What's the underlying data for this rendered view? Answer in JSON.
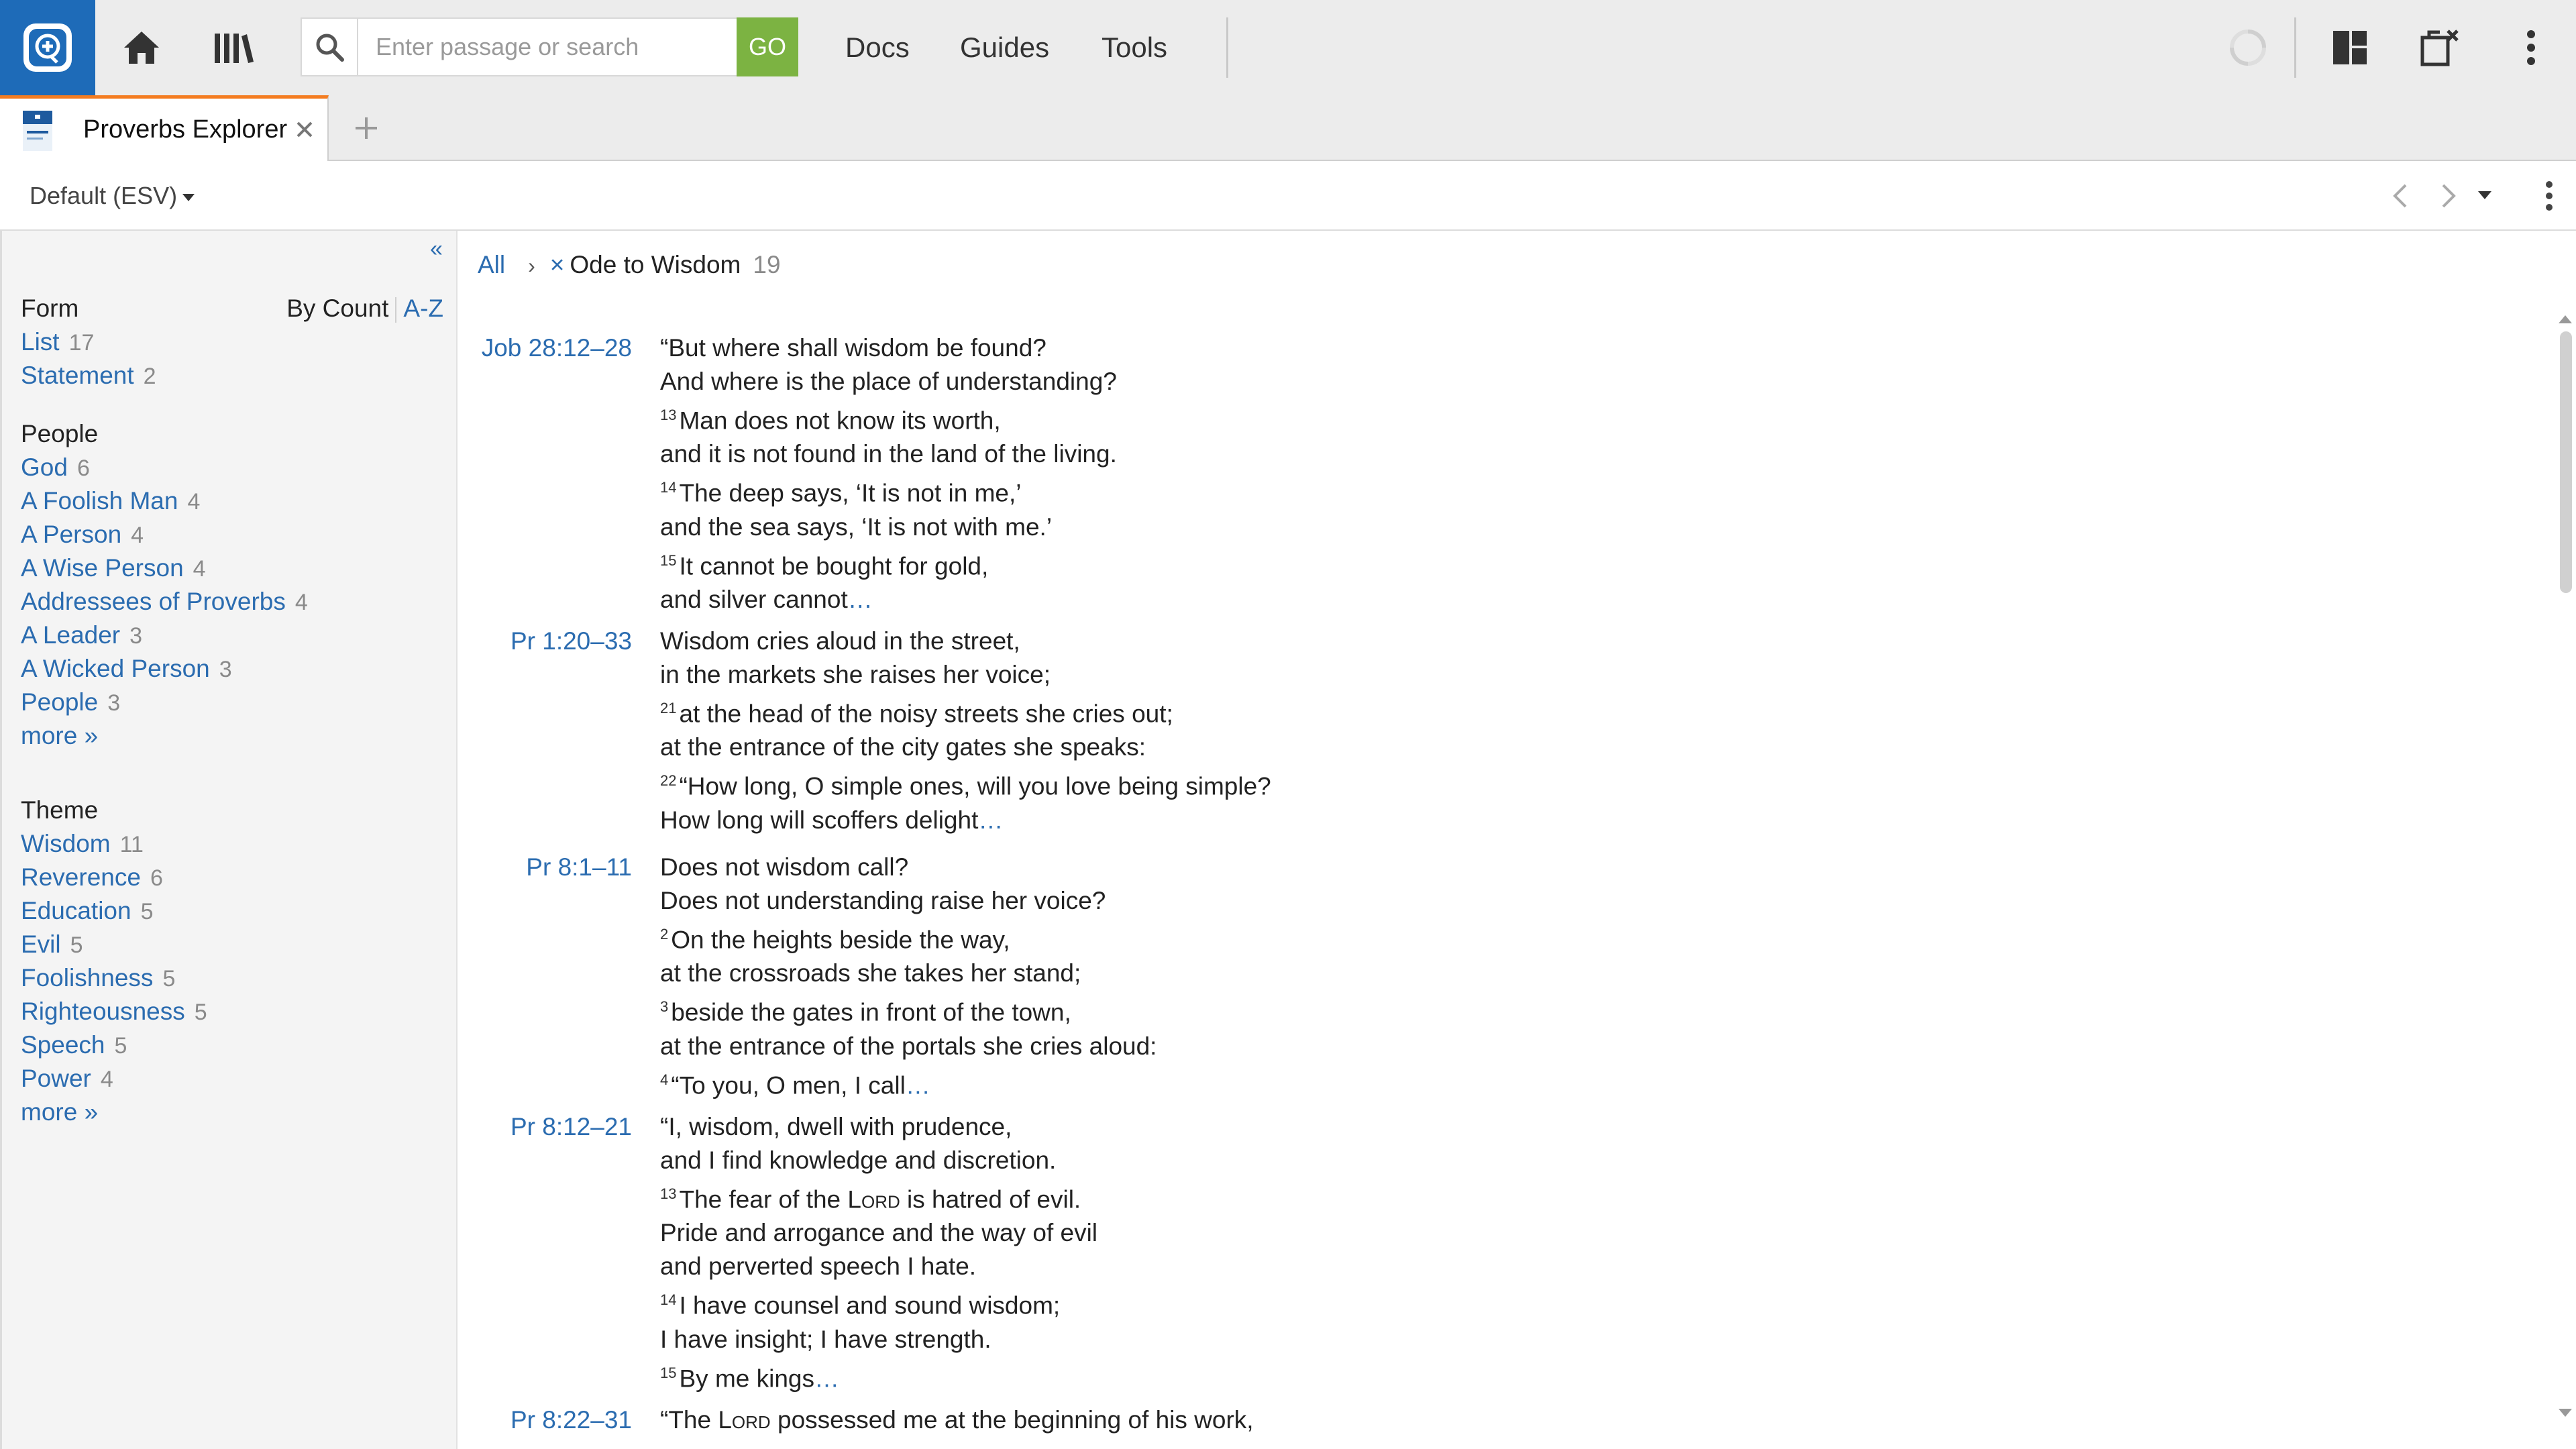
{
  "topbar": {
    "search_placeholder": "Enter passage or search",
    "go_label": "GO",
    "nav": [
      "Docs",
      "Guides",
      "Tools"
    ]
  },
  "tab": {
    "title": "Proverbs Explorer"
  },
  "toolbar": {
    "version_label": "Default (ESV)"
  },
  "sidebar": {
    "collapse_label": "«",
    "form": {
      "heading": "Form",
      "sort_by_count": "By Count",
      "sort_az": "A-Z",
      "items": [
        {
          "label": "List",
          "count": "17"
        },
        {
          "label": "Statement",
          "count": "2"
        }
      ]
    },
    "people": {
      "heading": "People",
      "items": [
        {
          "label": "God",
          "count": "6"
        },
        {
          "label": "A Foolish Man",
          "count": "4"
        },
        {
          "label": "A Person",
          "count": "4"
        },
        {
          "label": "A Wise Person",
          "count": "4"
        },
        {
          "label": "Addressees of Proverbs",
          "count": "4"
        },
        {
          "label": "A Leader",
          "count": "3"
        },
        {
          "label": "A Wicked Person",
          "count": "3"
        },
        {
          "label": "People",
          "count": "3"
        }
      ],
      "more": "more »"
    },
    "theme": {
      "heading": "Theme",
      "items": [
        {
          "label": "Wisdom",
          "count": "11"
        },
        {
          "label": "Reverence",
          "count": "6"
        },
        {
          "label": "Education",
          "count": "5"
        },
        {
          "label": "Evil",
          "count": "5"
        },
        {
          "label": "Foolishness",
          "count": "5"
        },
        {
          "label": "Righteousness",
          "count": "5"
        },
        {
          "label": "Speech",
          "count": "5"
        },
        {
          "label": "Power",
          "count": "4"
        }
      ],
      "more": "more »"
    }
  },
  "breadcrumb": {
    "all": "All",
    "sep": "›",
    "remove": "×",
    "current": "Ode to Wisdom",
    "count": "19"
  },
  "results": [
    {
      "ref": "Job 28:12–28",
      "lines": [
        {
          "v": "",
          "t": "“But where shall wisdom be found?"
        },
        {
          "v": "",
          "t": "And where is the place of understanding?"
        },
        {
          "v": "13",
          "t": "Man does not know its worth,"
        },
        {
          "v": "",
          "t": "and it is not found in the land of the living."
        },
        {
          "v": "14",
          "t": "The deep says, ‘It is not in me,’"
        },
        {
          "v": "",
          "t": "and the sea says, ‘It is not with me.’"
        },
        {
          "v": "15",
          "t": "It cannot be bought for gold,"
        },
        {
          "v": "",
          "t": "and silver cannot",
          "more": "…"
        }
      ]
    },
    {
      "ref": "Pr 1:20–33",
      "lines": [
        {
          "v": "",
          "t": "Wisdom cries aloud in the street,"
        },
        {
          "v": "",
          "t": "in the markets she raises her voice;"
        },
        {
          "v": "21",
          "t": "at the head of the noisy streets she cries out;"
        },
        {
          "v": "",
          "t": "at the entrance of the city gates she speaks:"
        },
        {
          "v": "22",
          "t": "“How long, O simple ones, will you love being simple?"
        },
        {
          "v": "",
          "t": "How long will scoffers delight",
          "more": "…"
        }
      ]
    },
    {
      "ref": "Pr 8:1–11",
      "lines": [
        {
          "v": "",
          "t": "Does not wisdom call?"
        },
        {
          "v": "",
          "t": "Does not understanding raise her voice?"
        },
        {
          "v": "2",
          "t": "On the heights beside the way,"
        },
        {
          "v": "",
          "t": "at the crossroads she takes her stand;"
        },
        {
          "v": "3",
          "t": "beside the gates in front of the town,"
        },
        {
          "v": "",
          "t": "at the entrance of the portals she cries aloud:"
        },
        {
          "v": "4",
          "t": "“To you, O men, I call",
          "more": "…"
        }
      ]
    },
    {
      "ref": "Pr 8:12–21",
      "lines": [
        {
          "v": "",
          "t": "“I, wisdom, dwell with prudence,"
        },
        {
          "v": "",
          "t": "and I find knowledge and discretion."
        },
        {
          "v": "13",
          "t": "The fear of the ",
          "sc": "Lord",
          "after": " is hatred of evil."
        },
        {
          "v": "",
          "t": "Pride and arrogance and the way of evil"
        },
        {
          "v": "",
          "t": "and perverted speech I hate."
        },
        {
          "v": "14",
          "t": "I have counsel and sound wisdom;"
        },
        {
          "v": "",
          "t": "I have insight; I have strength."
        },
        {
          "v": "15",
          "t": "By me kings",
          "more": "…"
        }
      ]
    },
    {
      "ref": "Pr 8:22–31",
      "lines": [
        {
          "v": "",
          "t": "“The ",
          "sc": "Lord",
          "after": " possessed me at the beginning of his work,"
        }
      ]
    }
  ]
}
